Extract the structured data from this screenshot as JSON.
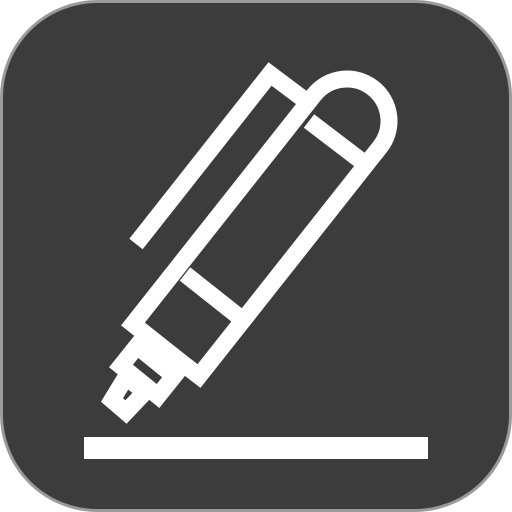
{
  "app_icon": {
    "icon_name": "pen-writing-icon",
    "background_color": "#3c3c3c",
    "border_color": "#9a9a9a",
    "glyph_color": "#ffffff"
  }
}
